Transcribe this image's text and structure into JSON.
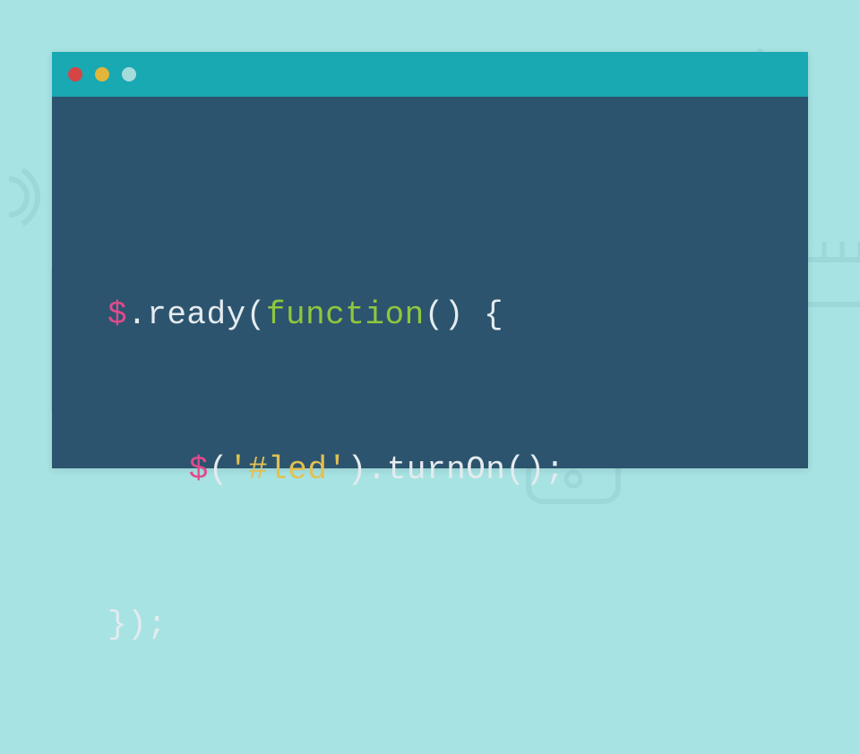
{
  "colors": {
    "background": "#a7e3e3",
    "titlebar": "#18a9b2",
    "editor_bg": "#2c546e",
    "traffic_red": "#d44646",
    "traffic_yellow": "#e2b63a",
    "traffic_cyan": "#a5dbdb",
    "token_default": "#e4ebef",
    "token_dollar": "#e04a8b",
    "token_keyword": "#8fc73e",
    "token_string": "#e2c152"
  },
  "code": {
    "line1": {
      "dollar": "$",
      "dot1": ".",
      "ready": "ready",
      "open_paren": "(",
      "keyword": "function",
      "empty_parens": "()",
      "space_brace": " {"
    },
    "line2": {
      "dollar": "$",
      "open_paren": "(",
      "string": "'#led'",
      "close_paren": ")",
      "dot": ".",
      "method": "turnOn",
      "call": "();"
    },
    "line3": {
      "close": "});"
    }
  }
}
